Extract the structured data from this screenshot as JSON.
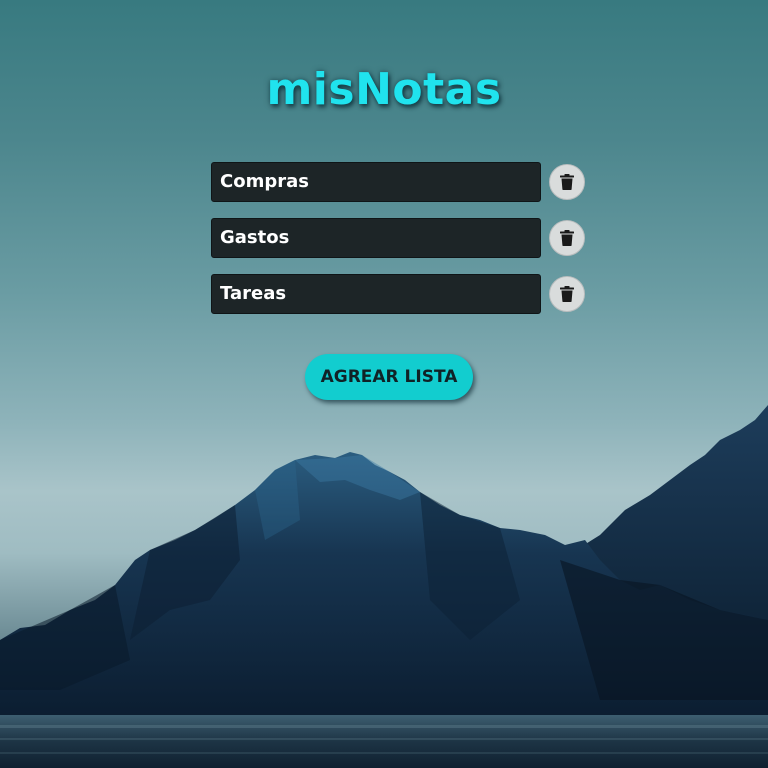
{
  "app": {
    "title": "misNotas"
  },
  "lists": [
    {
      "name": "Compras",
      "delete_icon": "trash-icon"
    },
    {
      "name": "Gastos",
      "delete_icon": "trash-icon"
    },
    {
      "name": "Tareas",
      "delete_icon": "trash-icon"
    }
  ],
  "actions": {
    "add_list_label": "AGREAR LISTA"
  },
  "colors": {
    "title": "#20e3ee",
    "accent_button": "#12cdcf",
    "field_background": "#1d2527",
    "delete_button": "#d9dcdc"
  }
}
